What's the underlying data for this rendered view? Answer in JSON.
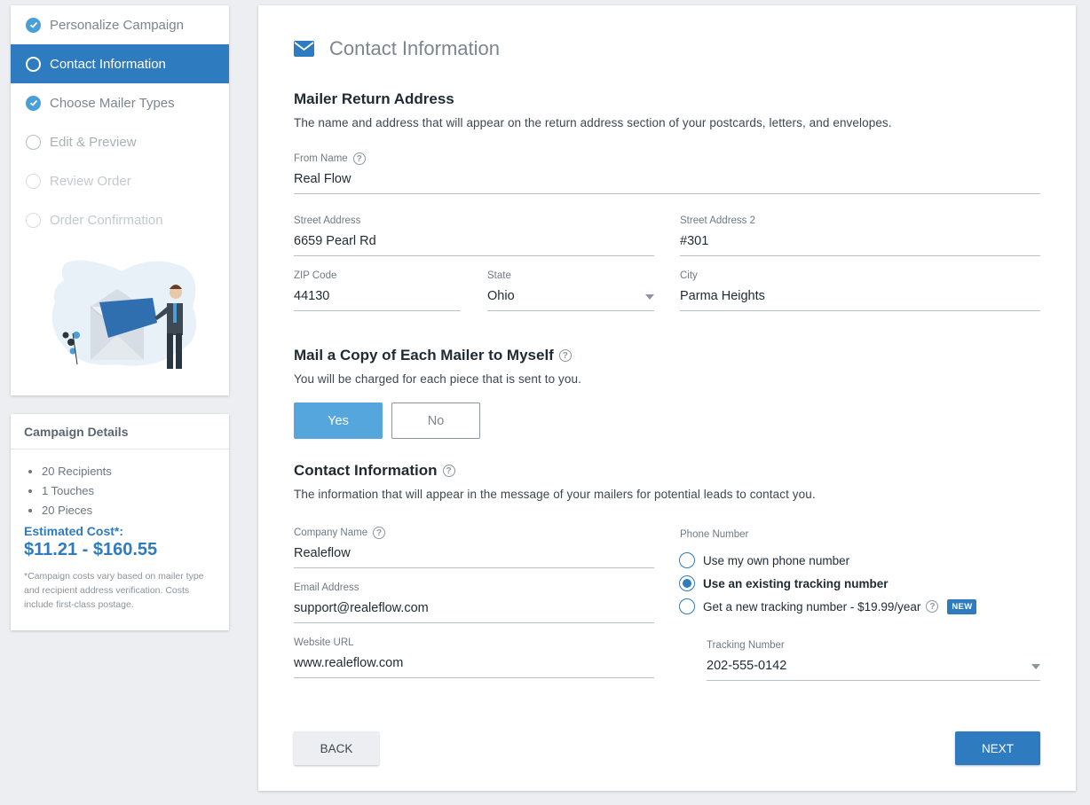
{
  "steps": [
    {
      "label": "Personalize Campaign",
      "state": "done"
    },
    {
      "label": "Contact Information",
      "state": "active"
    },
    {
      "label": "Choose Mailer Types",
      "state": "done"
    },
    {
      "label": "Edit & Preview",
      "state": "pending"
    },
    {
      "label": "Review Order",
      "state": "faint"
    },
    {
      "label": "Order Confirmation",
      "state": "faint"
    }
  ],
  "campaign": {
    "title": "Campaign Details",
    "items": [
      "20 Recipients",
      "1 Touches",
      "20 Pieces"
    ],
    "estimated_label": "Estimated Cost*:",
    "estimated_value": "$11.21 - $160.55",
    "note": "*Campaign costs vary based on mailer type and recipient address verification. Costs include first-class postage."
  },
  "header": {
    "title": "Contact Information",
    "icon": "envelope-icon"
  },
  "return_address": {
    "title": "Mailer Return Address",
    "desc": "The name and address that will appear on the return address section of your postcards, letters, and envelopes.",
    "from_name_label": "From Name",
    "from_name": "Real Flow",
    "street_label": "Street Address",
    "street": "6659 Pearl Rd",
    "street2_label": "Street Address 2",
    "street2": "#301",
    "zip_label": "ZIP Code",
    "zip": "44130",
    "state_label": "State",
    "state": "Ohio",
    "city_label": "City",
    "city": "Parma Heights"
  },
  "mail_copy": {
    "title": "Mail a Copy of Each Mailer to Myself",
    "desc": "You will be charged for each piece that is sent to you.",
    "yes": "Yes",
    "no": "No",
    "selected": "Yes"
  },
  "contact": {
    "title": "Contact Information",
    "desc": "The information that will appear in the message of your mailers for potential leads to contact you.",
    "company_label": "Company Name",
    "company": "Realeflow",
    "email_label": "Email Address",
    "email": "support@realeflow.com",
    "website_label": "Website URL",
    "website": "www.realeflow.com",
    "phone_label": "Phone Number",
    "phone_options": [
      "Use my own phone number",
      "Use an existing tracking number",
      "Get a new tracking number - $19.99/year"
    ],
    "phone_selected": 1,
    "new_badge": "NEW",
    "tracking_label": "Tracking Number",
    "tracking": "202-555-0142"
  },
  "nav": {
    "back": "BACK",
    "next": "NEXT"
  },
  "colors": {
    "primary": "#2f7bbf",
    "accent": "#55a6dd",
    "background": "#eceef1"
  }
}
